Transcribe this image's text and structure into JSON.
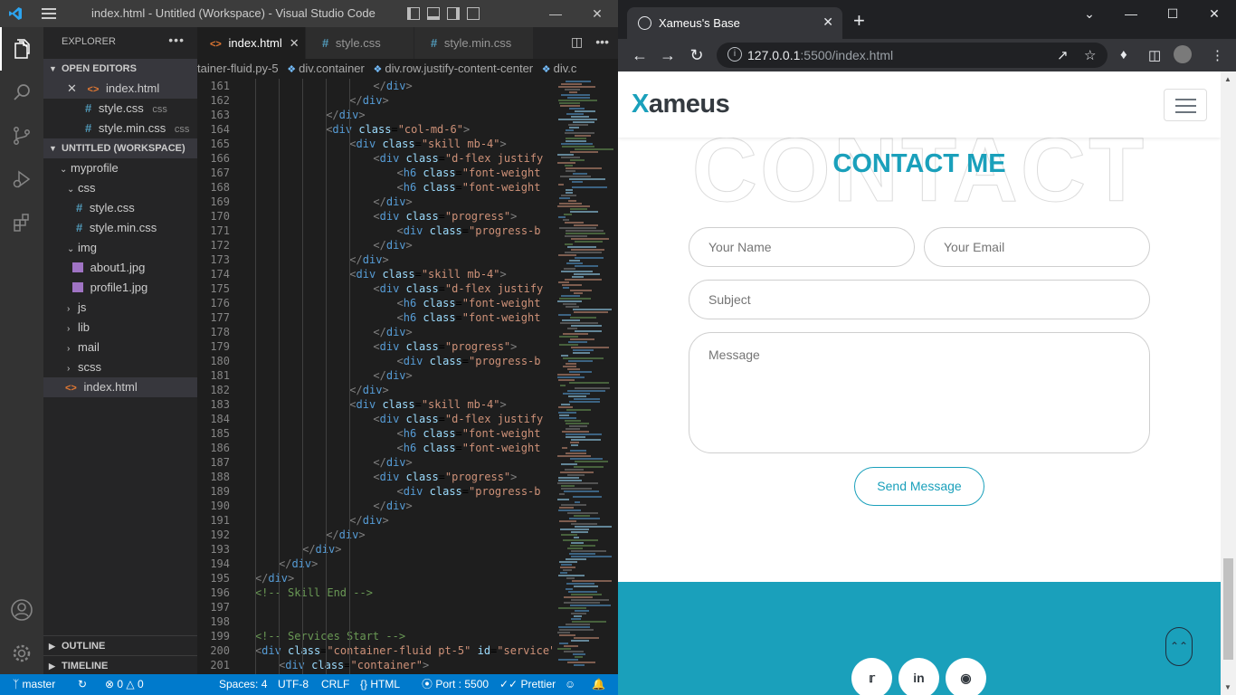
{
  "vscode": {
    "title": "index.html - Untitled (Workspace) - Visual Studio Code",
    "explorer_header": "EXPLORER",
    "open_editors_header": "OPEN EDITORS",
    "open_editors": [
      {
        "name": "index.html",
        "tag": ""
      },
      {
        "name": "style.css",
        "tag": "css"
      },
      {
        "name": "style.min.css",
        "tag": "css"
      }
    ],
    "workspace_header": "UNTITLED (WORKSPACE)",
    "tree": {
      "root": "myprofile",
      "css_folder": "css",
      "css_files": [
        "style.css",
        "style.min.css"
      ],
      "img_folder": "img",
      "img_files": [
        "about1.jpg",
        "profile1.jpg"
      ],
      "folders": [
        "js",
        "lib",
        "mail",
        "scss"
      ],
      "index_file": "index.html"
    },
    "outline_header": "OUTLINE",
    "timeline_header": "TIMELINE",
    "tabs": [
      "index.html",
      "style.css",
      "style.min.css"
    ],
    "breadcrumb": [
      "tainer-fluid.py-5",
      "div.container",
      "div.row.justify-content-center",
      "div.c"
    ],
    "code_lines": [
      {
        "n": "161",
        "indent": 16,
        "html": "<span class='tg'>&lt;/</span><span class='tn'>div</span><span class='tg'>&gt;</span>"
      },
      {
        "n": "162",
        "indent": 12,
        "html": "<span class='tg'>&lt;/</span><span class='tn'>div</span><span class='tg'>&gt;</span>"
      },
      {
        "n": "163",
        "indent": 8,
        "html": "<span class='tg'>&lt;/</span><span class='tn'>div</span><span class='tg'>&gt;</span>"
      },
      {
        "n": "164",
        "indent": 8,
        "html": "<span class='tg'>&lt;</span><span class='tn'>div</span> <span class='at'>class</span>=<span class='sv'>\"col-md-6\"</span><span class='tg'>&gt;</span>"
      },
      {
        "n": "165",
        "indent": 12,
        "html": "<span class='tg'>&lt;</span><span class='tn'>div</span> <span class='at'>class</span>=<span class='sv'>\"skill mb-4\"</span><span class='tg'>&gt;</span>"
      },
      {
        "n": "166",
        "indent": 16,
        "html": "<span class='tg'>&lt;</span><span class='tn'>div</span> <span class='at'>class</span>=<span class='sv'>\"d-flex justify</span>"
      },
      {
        "n": "167",
        "indent": 20,
        "html": "<span class='tg'>&lt;</span><span class='tn'>h6</span> <span class='at'>class</span>=<span class='sv'>\"font-weight</span>"
      },
      {
        "n": "168",
        "indent": 20,
        "html": "<span class='tg'>&lt;</span><span class='tn'>h6</span> <span class='at'>class</span>=<span class='sv'>\"font-weight</span>"
      },
      {
        "n": "169",
        "indent": 16,
        "html": "<span class='tg'>&lt;/</span><span class='tn'>div</span><span class='tg'>&gt;</span>"
      },
      {
        "n": "170",
        "indent": 16,
        "html": "<span class='tg'>&lt;</span><span class='tn'>div</span> <span class='at'>class</span>=<span class='sv'>\"progress\"</span><span class='tg'>&gt;</span>"
      },
      {
        "n": "171",
        "indent": 20,
        "html": "<span class='tg'>&lt;</span><span class='tn'>div</span> <span class='at'>class</span>=<span class='sv'>\"progress-b</span>"
      },
      {
        "n": "172",
        "indent": 16,
        "html": "<span class='tg'>&lt;/</span><span class='tn'>div</span><span class='tg'>&gt;</span>"
      },
      {
        "n": "173",
        "indent": 12,
        "html": "<span class='tg'>&lt;/</span><span class='tn'>div</span><span class='tg'>&gt;</span>"
      },
      {
        "n": "174",
        "indent": 12,
        "html": "<span class='tg'>&lt;</span><span class='tn'>div</span> <span class='at'>class</span>=<span class='sv'>\"skill mb-4\"</span><span class='tg'>&gt;</span>"
      },
      {
        "n": "175",
        "indent": 16,
        "html": "<span class='tg'>&lt;</span><span class='tn'>div</span> <span class='at'>class</span>=<span class='sv'>\"d-flex justify</span>"
      },
      {
        "n": "176",
        "indent": 20,
        "html": "<span class='tg'>&lt;</span><span class='tn'>h6</span> <span class='at'>class</span>=<span class='sv'>\"font-weight</span>"
      },
      {
        "n": "177",
        "indent": 20,
        "html": "<span class='tg'>&lt;</span><span class='tn'>h6</span> <span class='at'>class</span>=<span class='sv'>\"font-weight</span>"
      },
      {
        "n": "178",
        "indent": 16,
        "html": "<span class='tg'>&lt;/</span><span class='tn'>div</span><span class='tg'>&gt;</span>"
      },
      {
        "n": "179",
        "indent": 16,
        "html": "<span class='tg'>&lt;</span><span class='tn'>div</span> <span class='at'>class</span>=<span class='sv'>\"progress\"</span><span class='tg'>&gt;</span>"
      },
      {
        "n": "180",
        "indent": 20,
        "html": "<span class='tg'>&lt;</span><span class='tn'>div</span> <span class='at'>class</span>=<span class='sv'>\"progress-b</span>"
      },
      {
        "n": "181",
        "indent": 16,
        "html": "<span class='tg'>&lt;/</span><span class='tn'>div</span><span class='tg'>&gt;</span>"
      },
      {
        "n": "182",
        "indent": 12,
        "html": "<span class='tg'>&lt;/</span><span class='tn'>div</span><span class='tg'>&gt;</span>"
      },
      {
        "n": "183",
        "indent": 12,
        "html": "<span class='tg'>&lt;</span><span class='tn'>div</span> <span class='at'>class</span>=<span class='sv'>\"skill mb-4\"</span><span class='tg'>&gt;</span>"
      },
      {
        "n": "184",
        "indent": 16,
        "html": "<span class='tg'>&lt;</span><span class='tn'>div</span> <span class='at'>class</span>=<span class='sv'>\"d-flex justify</span>"
      },
      {
        "n": "185",
        "indent": 20,
        "html": "<span class='tg'>&lt;</span><span class='tn'>h6</span> <span class='at'>class</span>=<span class='sv'>\"font-weight</span>"
      },
      {
        "n": "186",
        "indent": 20,
        "html": "<span class='tg'>&lt;</span><span class='tn'>h6</span> <span class='at'>class</span>=<span class='sv'>\"font-weight</span>"
      },
      {
        "n": "187",
        "indent": 16,
        "html": "<span class='tg'>&lt;/</span><span class='tn'>div</span><span class='tg'>&gt;</span>"
      },
      {
        "n": "188",
        "indent": 16,
        "html": "<span class='tg'>&lt;</span><span class='tn'>div</span> <span class='at'>class</span>=<span class='sv'>\"progress\"</span><span class='tg'>&gt;</span>"
      },
      {
        "n": "189",
        "indent": 20,
        "html": "<span class='tg'>&lt;</span><span class='tn'>div</span> <span class='at'>class</span>=<span class='sv'>\"progress-b</span>"
      },
      {
        "n": "190",
        "indent": 16,
        "html": "<span class='tg'>&lt;/</span><span class='tn'>div</span><span class='tg'>&gt;</span>"
      },
      {
        "n": "191",
        "indent": 12,
        "html": "<span class='tg'>&lt;/</span><span class='tn'>div</span><span class='tg'>&gt;</span>"
      },
      {
        "n": "192",
        "indent": 8,
        "html": "<span class='tg'>&lt;/</span><span class='tn'>div</span><span class='tg'>&gt;</span>"
      },
      {
        "n": "193",
        "indent": 4,
        "html": "<span class='tg'>&lt;/</span><span class='tn'>div</span><span class='tg'>&gt;</span>"
      },
      {
        "n": "194",
        "indent": 0,
        "html": "<span class='tg'>&lt;/</span><span class='tn'>div</span><span class='tg'>&gt;</span>"
      },
      {
        "n": "195",
        "indent": -4,
        "html": "<span class='tg'>&lt;/</span><span class='tn'>div</span><span class='tg'>&gt;</span>"
      },
      {
        "n": "196",
        "indent": -4,
        "html": "<span class='cm'>&lt;!-- Skill End --&gt;</span>"
      },
      {
        "n": "197",
        "indent": -4,
        "html": ""
      },
      {
        "n": "198",
        "indent": -4,
        "html": ""
      },
      {
        "n": "199",
        "indent": -4,
        "html": "<span class='cm'>&lt;!-- Services Start --&gt;</span>"
      },
      {
        "n": "200",
        "indent": -4,
        "html": "<span class='tg'>&lt;</span><span class='tn'>div</span> <span class='at'>class</span>=<span class='sv'>\"container-fluid pt-5\"</span> <span class='at'>id</span>=<span class='sv'>\"service\"</span>"
      },
      {
        "n": "201",
        "indent": 0,
        "html": "<span class='tg'>&lt;</span><span class='tn'>div</span> <span class='at'>class</span>=<span class='sv'>\"container\"</span><span class='tg'>&gt;</span>"
      }
    ],
    "status": {
      "branch": "master",
      "errors": "0",
      "warnings": "0",
      "spaces": "Spaces: 4",
      "encoding": "UTF-8",
      "eol": "CRLF",
      "language": "HTML",
      "port": "Port : 5500",
      "prettier": "Prettier"
    },
    "colors": {
      "accent": "#007acc",
      "activity": "#333333",
      "sidebar": "#252526"
    }
  },
  "chrome": {
    "tab_title": "Xameus's Base",
    "url_host": "127.0.0.1",
    "url_path": ":5500/index.html"
  },
  "site": {
    "brand_first": "X",
    "brand_rest": "ameus",
    "bg_title": "CONTACT",
    "section_title": "CONTACT ME",
    "form": {
      "name_placeholder": "Your Name",
      "email_placeholder": "Your Email",
      "subject_placeholder": "Subject",
      "message_placeholder": "Message",
      "send_label": "Send Message"
    },
    "social": [
      "twitter-icon",
      "linkedin-icon",
      "instagram-icon"
    ],
    "colors": {
      "primary": "#1aa0bb",
      "dark": "#343a40"
    }
  }
}
